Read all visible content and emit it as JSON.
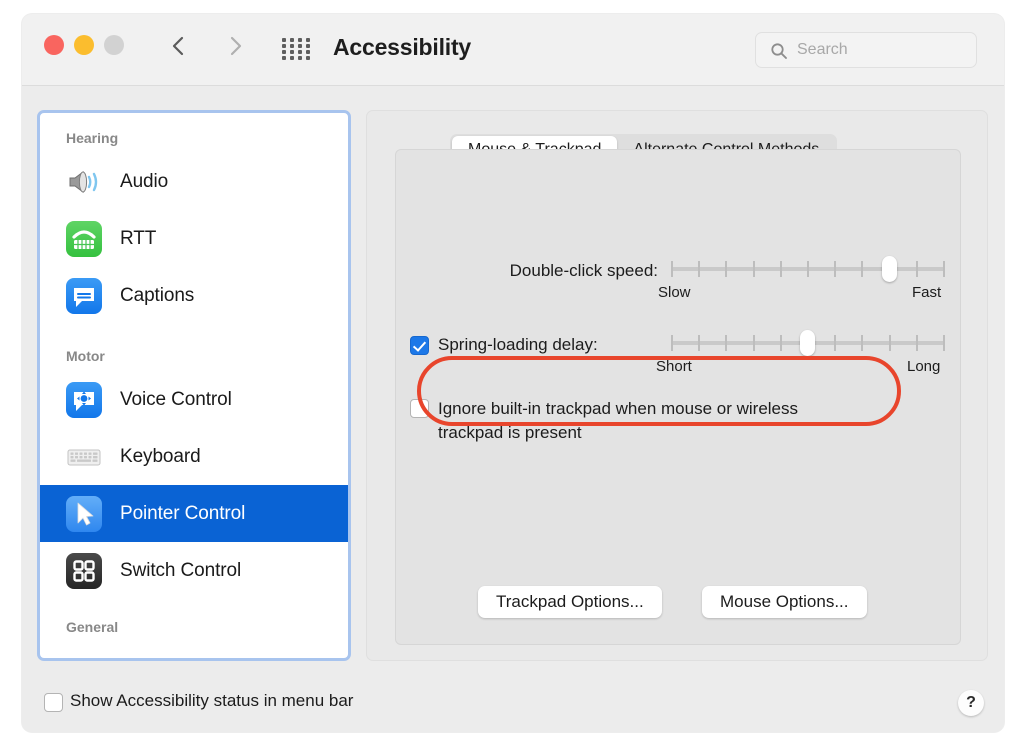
{
  "window": {
    "title": "Accessibility",
    "traffic_lights": [
      "close-red",
      "minimize-yellow",
      "zoom-grey"
    ],
    "back_icon": "chevron-left-icon",
    "forward_icon": "chevron-right-icon",
    "grid_icon": "show-all-grid-icon"
  },
  "search": {
    "placeholder": "Search",
    "value": "",
    "icon": "search-icon"
  },
  "sidebar": {
    "groups": [
      {
        "label": "Hearing",
        "items": [
          {
            "label": "Audio",
            "icon": "speaker-audio-icon",
            "selected": false
          },
          {
            "label": "RTT",
            "icon": "rtt-phone-icon",
            "selected": false
          },
          {
            "label": "Captions",
            "icon": "captions-bubble-icon",
            "selected": false
          }
        ]
      },
      {
        "label": "Motor",
        "items": [
          {
            "label": "Voice Control",
            "icon": "voice-control-icon",
            "selected": false
          },
          {
            "label": "Keyboard",
            "icon": "keyboard-icon",
            "selected": false
          },
          {
            "label": "Pointer Control",
            "icon": "pointer-control-icon",
            "selected": true
          },
          {
            "label": "Switch Control",
            "icon": "switch-control-icon",
            "selected": false
          }
        ]
      },
      {
        "label": "General",
        "items": []
      }
    ],
    "selection_color": "#0a63d4",
    "focus_ring_color": "#a8c4ee"
  },
  "main": {
    "tabs": [
      {
        "label": "Mouse & Trackpad",
        "active": true
      },
      {
        "label": "Alternate Control Methods",
        "active": false
      }
    ],
    "double_click": {
      "label": "Double-click speed:",
      "min_label": "Slow",
      "max_label": "Fast",
      "ticks": 11,
      "value_index": 8
    },
    "spring_loading": {
      "label": "Spring-loading delay:",
      "checked": true,
      "min_label": "Short",
      "max_label": "Long",
      "ticks": 11,
      "value_index": 5
    },
    "ignore_trackpad": {
      "line1": "Ignore built-in trackpad when mouse or wireless",
      "line2": "trackpad is present",
      "checked": false,
      "annotation_color": "#e8452c"
    },
    "buttons": [
      {
        "label": "Trackpad Options..."
      },
      {
        "label": "Mouse Options..."
      }
    ]
  },
  "footer": {
    "status_label": "Show Accessibility status in menu bar",
    "status_checked": false,
    "help_label": "?"
  }
}
